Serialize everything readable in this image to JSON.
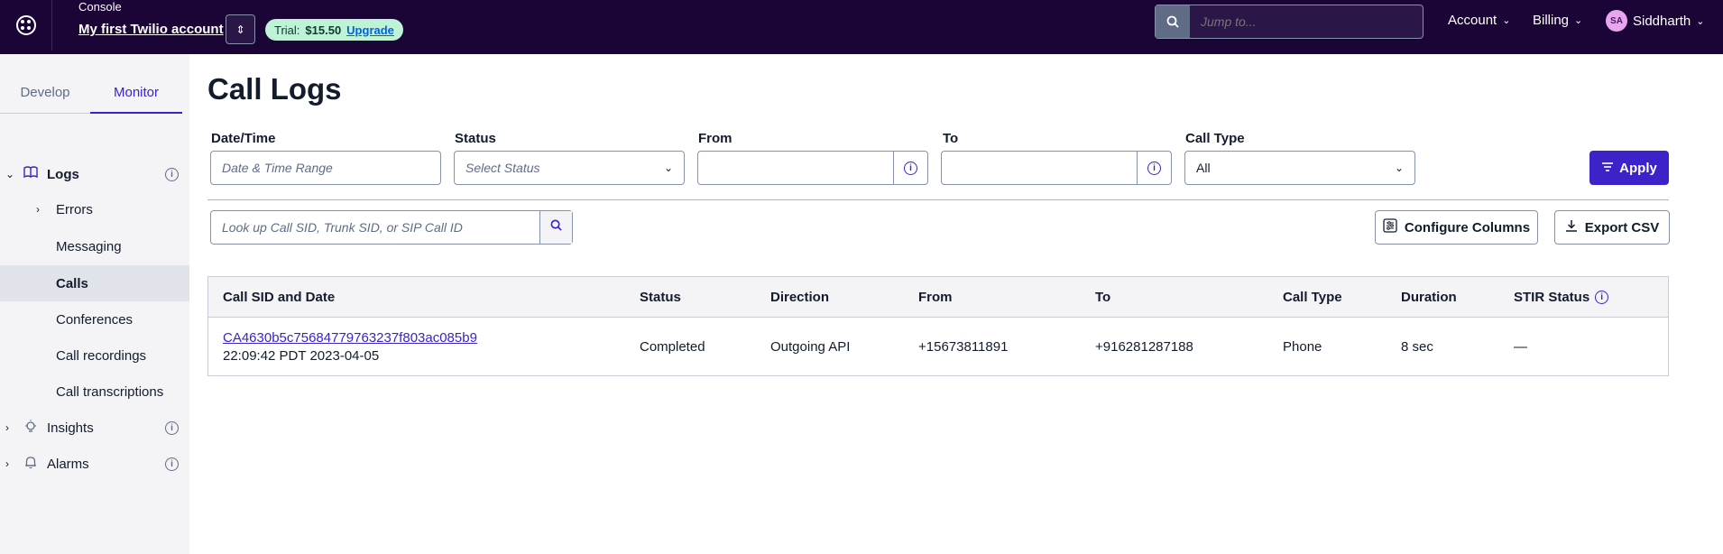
{
  "header": {
    "console_label": "Console",
    "account_name": "My first Twilio account",
    "trial_label": "Trial:",
    "trial_amount": "$15.50",
    "upgrade_label": "Upgrade",
    "jump_placeholder": "Jump to...",
    "account_menu": "Account",
    "billing_menu": "Billing",
    "user_initials": "SA",
    "user_name": "Siddharth",
    "brand_color": "#1a0536"
  },
  "sidebar": {
    "tabs": [
      {
        "label": "Develop",
        "active": false
      },
      {
        "label": "Monitor",
        "active": true
      }
    ],
    "sections": [
      {
        "label": "Logs",
        "icon": "book-icon"
      },
      {
        "label": "Insights",
        "icon": "lightbulb-icon"
      },
      {
        "label": "Alarms",
        "icon": "bell-icon"
      }
    ],
    "log_items": [
      "Errors",
      "Messaging",
      "Calls",
      "Conferences",
      "Call recordings",
      "Call transcriptions"
    ],
    "selected_item": "Calls"
  },
  "main": {
    "title": "Call Logs",
    "filters": {
      "datetime_label": "Date/Time",
      "datetime_placeholder": "Date & Time Range",
      "status_label": "Status",
      "status_placeholder": "Select Status",
      "from_label": "From",
      "to_label": "To",
      "calltype_label": "Call Type",
      "calltype_value": "All",
      "apply_label": "Apply"
    },
    "lookup_placeholder": "Look up Call SID, Trunk SID, or SIP Call ID",
    "configure_columns_label": "Configure Columns",
    "export_csv_label": "Export CSV",
    "accent_color": "#3b22c9"
  },
  "table": {
    "columns": [
      "Call SID and Date",
      "Status",
      "Direction",
      "From",
      "To",
      "Call Type",
      "Duration",
      "STIR Status"
    ],
    "rows": [
      {
        "sid": "CA4630b5c75684779763237f803ac085b9",
        "date": "22:09:42 PDT 2023-04-05",
        "status": "Completed",
        "direction": "Outgoing API",
        "from": "+15673811891",
        "to": "+916281287188",
        "call_type": "Phone",
        "duration": "8 sec",
        "stir_status": "—"
      }
    ]
  }
}
